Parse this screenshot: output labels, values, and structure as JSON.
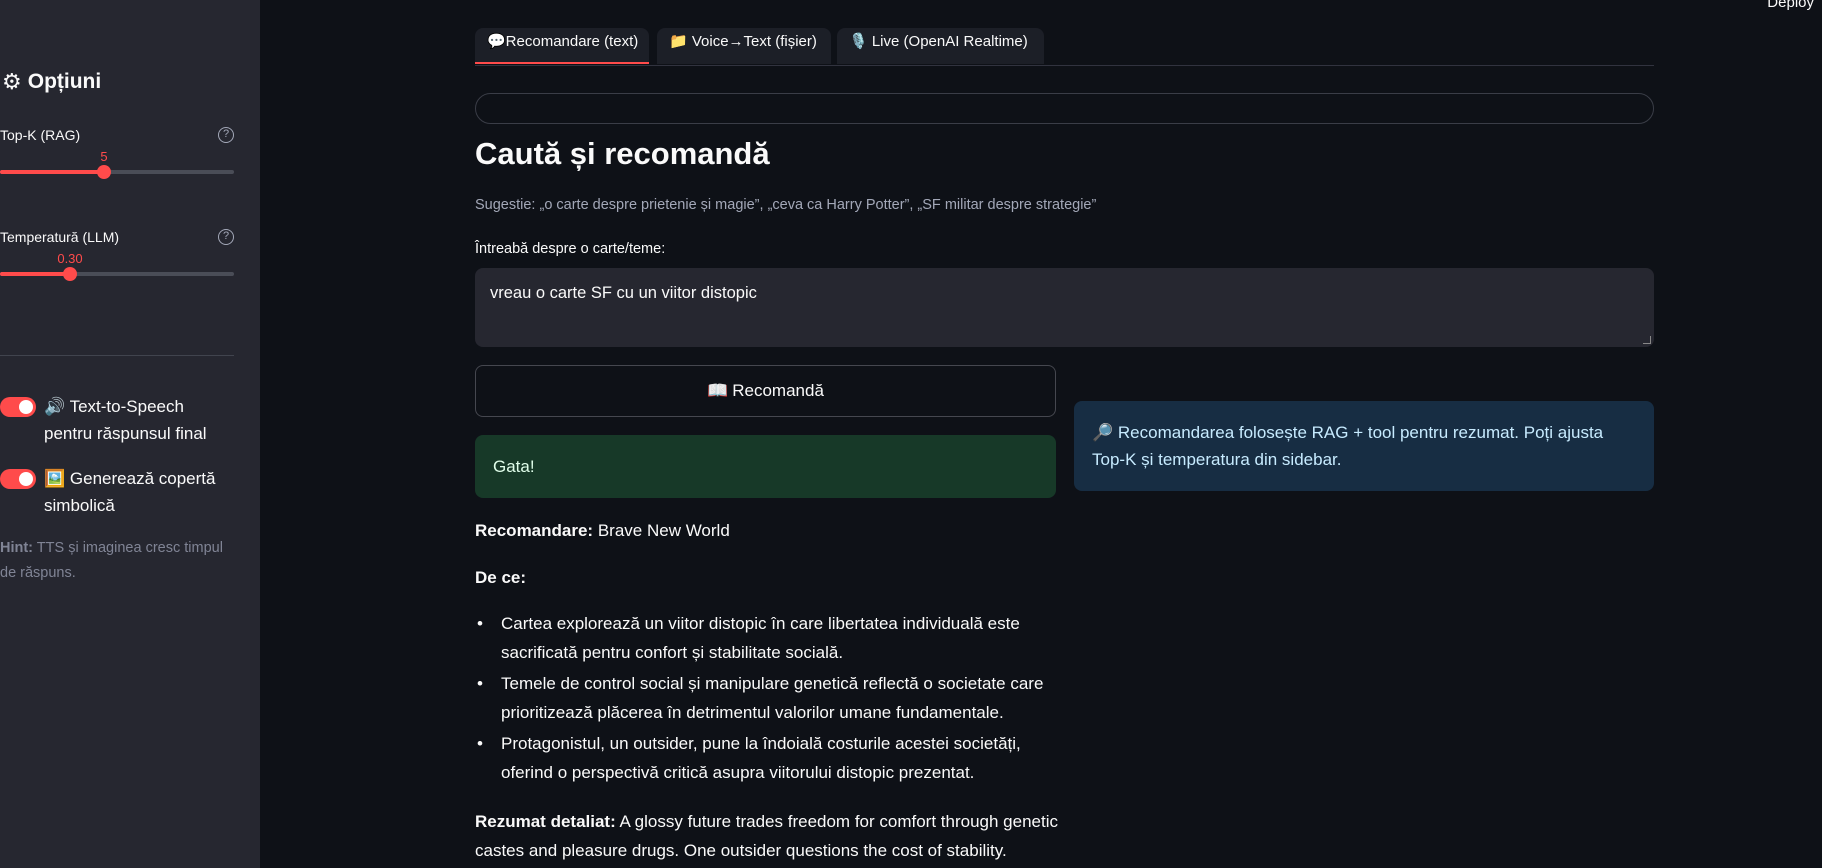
{
  "deploy_label": "Deploy",
  "sidebar": {
    "title": "Opțiuni",
    "gear_icon": "gear-icon",
    "topk": {
      "label": "Top-K (RAG)",
      "value": "5",
      "fraction": 0.444
    },
    "temperature": {
      "label": "Temperatură (LLM)",
      "value": "0.30",
      "fraction": 0.3
    },
    "tts_toggle": {
      "icon": "🔊",
      "label": "Text-to-Speech pentru răspunsul final",
      "on": true
    },
    "cover_toggle": {
      "icon": "🖼️",
      "label": "Generează copertă simbolică",
      "on": true
    },
    "hint_bold": "Hint:",
    "hint_text": " TTS și imaginea cresc timpul de răspuns."
  },
  "tabs": [
    {
      "label": "💬Recomandare (text)",
      "active": true
    },
    {
      "label": "📁 Voice→Text (fișier)",
      "active": false
    },
    {
      "label": "🎙️ Live (OpenAI Realtime)",
      "active": false
    }
  ],
  "main": {
    "title": "Caută și recomandă",
    "caption": "Sugestie: „o carte despre prietenie și magie”, „ceva ca Harry Potter”, „SF militar despre strategie”",
    "textarea_label": "Întreabă despre o carte/teme:",
    "textarea_value": "vreau o carte SF cu un viitor distopic",
    "button_icon": "📖",
    "button_label": "Recomandă",
    "success_text": "Gata!",
    "info_icon": "🔎",
    "info_text": "Recomandarea folosește RAG + tool pentru rezumat. Poți ajusta Top-K și temperatura din sidebar.",
    "rec_label": "Recomandare:",
    "rec_value": " Brave New World",
    "why_label": "De ce:",
    "bullets": [
      "Cartea explorează un viitor distopic în care libertatea individuală este sacrificată pentru confort și stabilitate socială.",
      "Temele de control social și manipulare genetică reflectă o societate care prioritizează plăcerea în detrimentul valorilor umane fundamentale.",
      "Protagonistul, un outsider, pune la îndoială costurile acestei societăți, oferind o perspectivă critică asupra viitorului distopic prezentat."
    ],
    "summary_label": "Rezumat detaliat:",
    "summary_text": " A glossy future trades freedom for comfort through genetic castes and pleasure drugs. One outsider questions the cost of stability."
  }
}
